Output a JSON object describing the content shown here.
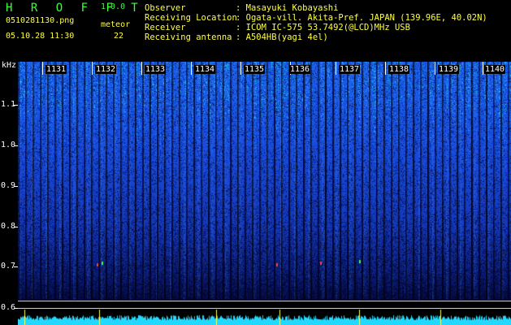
{
  "header": {
    "brand": "H R O F F T",
    "version": "1.0.0",
    "filename": "0510281130.png",
    "timestamp": "05.10.28 11:30",
    "meteor_label": "meteor",
    "meteor_count": "22"
  },
  "info": [
    {
      "label": "Observer",
      "value": ": Masayuki Kobayashi"
    },
    {
      "label": "Receiving Location",
      "value": ": Ogata-vill. Akita-Pref. JAPAN (139.96E, 40.02N)"
    },
    {
      "label": "Receiver",
      "value": ": ICOM IC-575 53.7492(@LCD)MHz USB"
    },
    {
      "label": "Receiving antenna",
      "value": ": A504HB(yagi 4el)"
    }
  ],
  "axis": {
    "unit": "kHz",
    "y_labels": [
      "1.1",
      "1.0",
      "0.9",
      "0.8",
      "0.7",
      "0.6"
    ],
    "x_labels": [
      "1131",
      "1132",
      "1133",
      "1134",
      "1135",
      "1136",
      "1137",
      "1138",
      "1139",
      "1140"
    ]
  },
  "colors": {
    "background": "#000000",
    "title_green": "#3cff3c",
    "info_yellow": "#ffff40",
    "spectrum_blue": "#1a4ee0",
    "trace_cyan": "#22d8ff"
  }
}
